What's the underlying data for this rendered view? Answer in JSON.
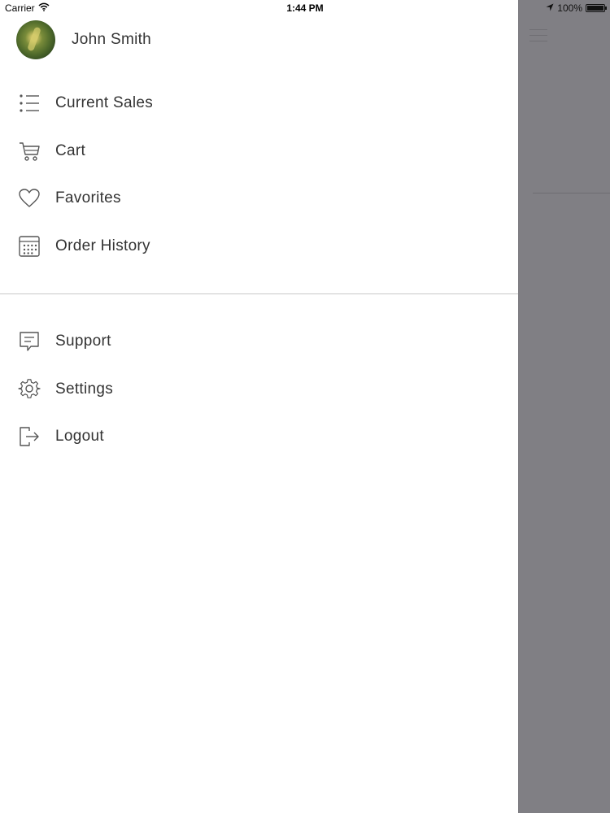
{
  "status_bar": {
    "carrier": "Carrier",
    "time": "1:44 PM",
    "battery": "100%",
    "wifi_icon": "wifi-icon",
    "location_icon": "location-arrow-icon",
    "battery_icon": "battery-full-icon",
    "battery_level": 1.0
  },
  "profile": {
    "name": "John Smith",
    "avatar_icon": "avatar-photo"
  },
  "menu": {
    "primary": [
      {
        "label": "Current Sales",
        "icon": "list-icon"
      },
      {
        "label": "Cart",
        "icon": "cart-icon"
      },
      {
        "label": "Favorites",
        "icon": "heart-icon"
      },
      {
        "label": "Order History",
        "icon": "calendar-icon"
      }
    ],
    "secondary": [
      {
        "label": "Support",
        "icon": "chat-bubble-icon"
      },
      {
        "label": "Settings",
        "icon": "gear-icon"
      },
      {
        "label": "Logout",
        "icon": "logout-icon"
      }
    ]
  },
  "colors": {
    "drawer_background": "#ffffff",
    "overlay": "#807f84",
    "text": "#333333",
    "icon_stroke": "#555555",
    "divider": "#c8c8c8"
  }
}
